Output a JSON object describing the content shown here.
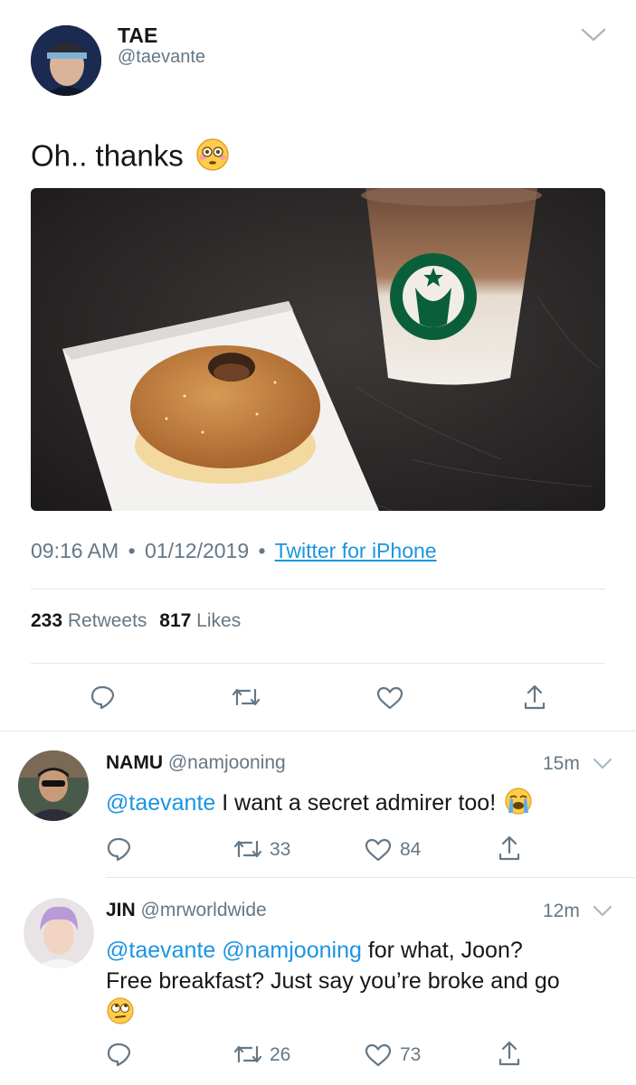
{
  "tweet": {
    "author_name": "TAE",
    "author_handle": "@taevante",
    "text": "Oh.. thanks",
    "text_emoji": "flushed-face",
    "time": "09:16 AM",
    "date": "01/12/2019",
    "sep": "•",
    "source": "Twitter for iPhone",
    "retweets_count": "233",
    "retweets_label": "Retweets",
    "likes_count": "817",
    "likes_label": "Likes",
    "image_subject": "donut-and-iced-coffee-photo"
  },
  "replies": [
    {
      "author_name": "NAMU",
      "author_handle": "@namjooning",
      "age": "15m",
      "mention": "@taevante",
      "text": " I want a secret admirer too!",
      "emoji": "loudly-crying-face",
      "retweets": "33",
      "likes": "84"
    },
    {
      "author_name": "JIN",
      "author_handle": "@mrworldwide",
      "age": "12m",
      "mention": "@taevante @namjooning",
      "text_line1": " for what, Joon?",
      "text_line2": "Free breakfast? Just say you’re broke and go",
      "emoji": "face-with-rolling-eyes",
      "retweets": "26",
      "likes": "73"
    }
  ],
  "colors": {
    "text": "#14171a",
    "muted": "#657786",
    "link": "#1b95e0",
    "divider": "#e1e8ed"
  }
}
